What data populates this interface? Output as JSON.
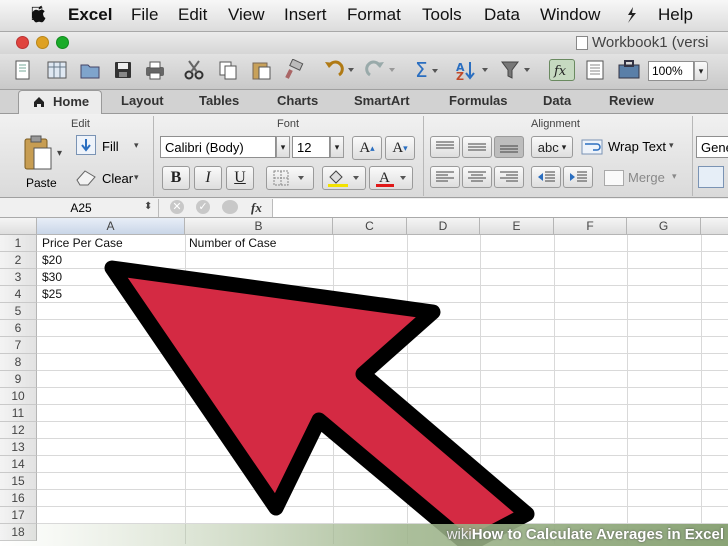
{
  "menubar": {
    "app": "Excel",
    "items": [
      "File",
      "Edit",
      "View",
      "Insert",
      "Format",
      "Tools",
      "Data",
      "Window",
      "Help"
    ]
  },
  "window": {
    "title": "Workbook1 (versi"
  },
  "toolbar": {
    "zoom": "100%"
  },
  "tabs": [
    "Home",
    "Layout",
    "Tables",
    "Charts",
    "SmartArt",
    "Formulas",
    "Data",
    "Review"
  ],
  "ribbon": {
    "groups": {
      "edit": "Edit",
      "font": "Font",
      "alignment": "Alignment"
    },
    "paste": "Paste",
    "fill": "Fill",
    "clear": "Clear",
    "font_name": "Calibri (Body)",
    "font_size": "12",
    "bold": "B",
    "italic": "I",
    "underline": "U",
    "grow": "A",
    "shrink": "A",
    "font_color_letter": "A",
    "orientation": "abc",
    "wrap_text": "Wrap Text",
    "merge": "Merge",
    "number_format": "Gene"
  },
  "formula_bar": {
    "name_box": "A25",
    "fx": "fx",
    "content": ""
  },
  "sheet": {
    "columns": [
      "A",
      "B",
      "C",
      "D",
      "E",
      "F",
      "G"
    ],
    "rows": [
      "1",
      "2",
      "3",
      "4",
      "5",
      "6",
      "7",
      "8",
      "9",
      "10",
      "11",
      "12",
      "13",
      "14",
      "15",
      "16",
      "17",
      "18"
    ],
    "cells": {
      "A1": "Price Per Case",
      "B1": "Number of Case",
      "A2": "$20",
      "A3": "$30",
      "A4": "$25"
    }
  },
  "overlay": {
    "arrow_color": "#d42a43"
  },
  "watermark": {
    "prefix": "wiki",
    "text": "How to Calculate Averages in Excel"
  }
}
